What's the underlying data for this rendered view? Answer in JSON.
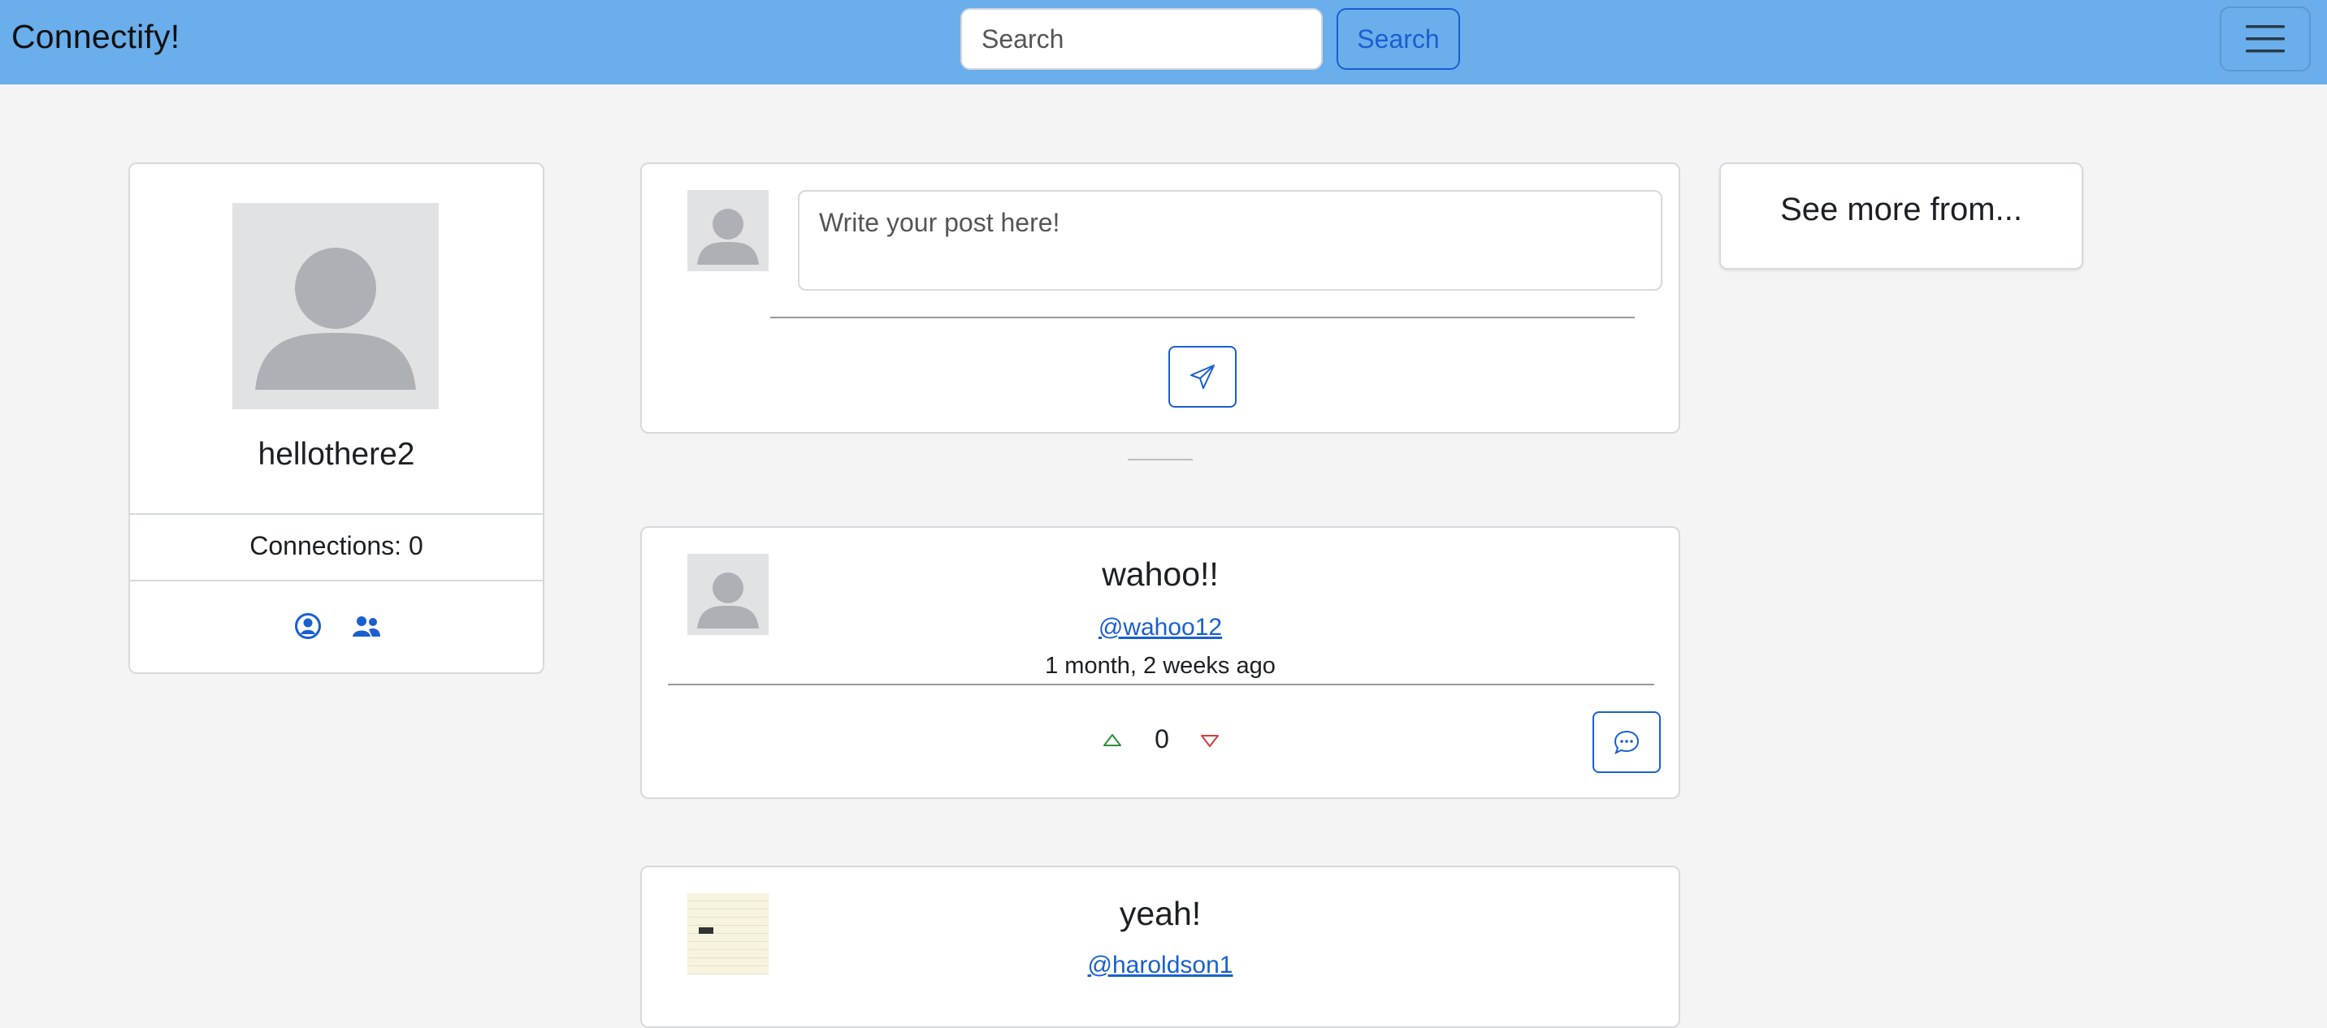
{
  "navbar": {
    "brand": "Connectify!",
    "search_placeholder": "Search",
    "search_button": "Search",
    "menu_icon": "hamburger-icon"
  },
  "profile": {
    "username": "hellothere2",
    "connections": "Connections: 0",
    "icons": [
      "user-circle-icon",
      "people-icon"
    ],
    "accent_color": "#1a5fd0"
  },
  "composer": {
    "placeholder": "Write your post here!",
    "send_icon": "send-icon"
  },
  "posts": [
    {
      "title": "wahoo!!",
      "user": "@wahoo12",
      "time": "1 month, 2 weeks ago",
      "votes": "0",
      "upvote_color": "#2e8b3e",
      "downvote_color": "#d23b3b"
    },
    {
      "title": "yeah!",
      "user": "@haroldson1"
    }
  ],
  "sidebar": {
    "see_more_title": "See more from..."
  }
}
